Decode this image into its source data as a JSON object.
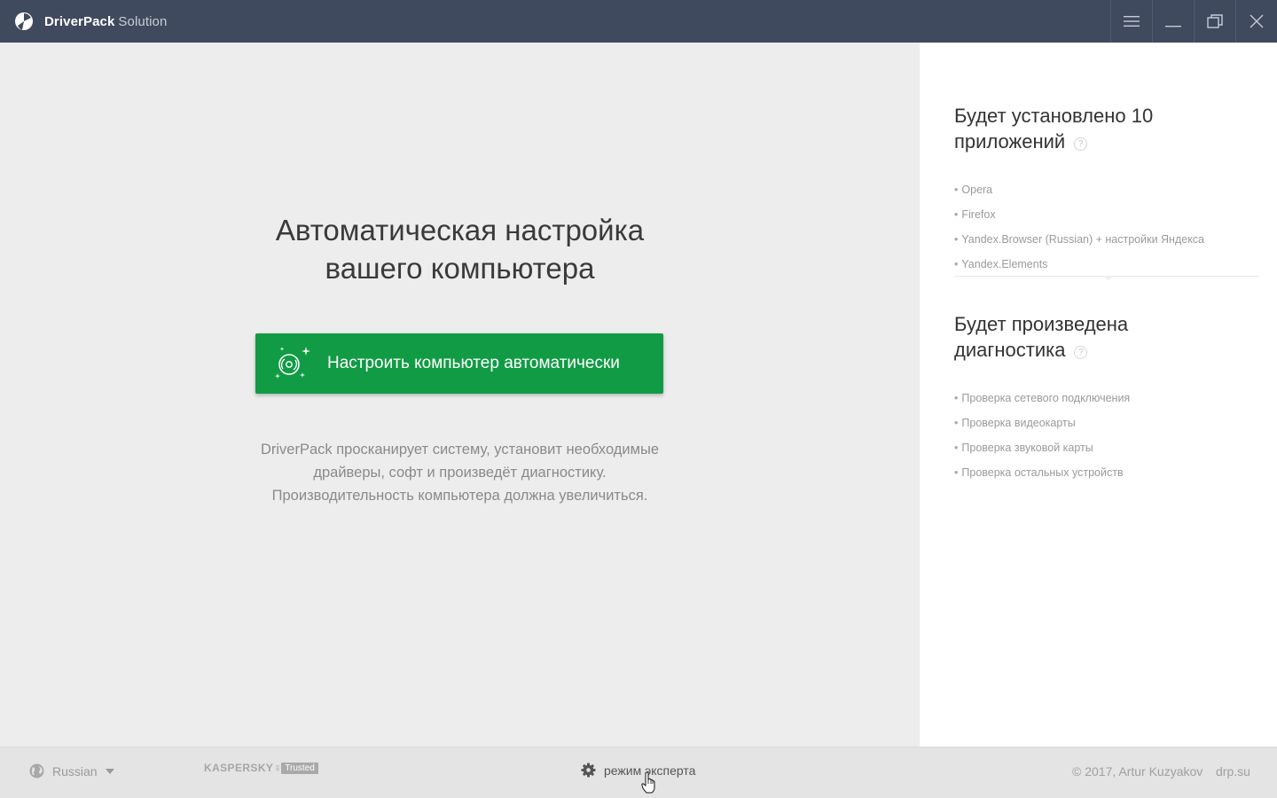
{
  "titlebar": {
    "brand_bold": "DriverPack",
    "brand_light": "Solution",
    "icons": [
      "driverpack-logo-icon",
      "menu-icon",
      "minimize-icon",
      "restore-icon",
      "close-icon"
    ]
  },
  "main": {
    "headline": [
      "Автоматическая настройка",
      "вашего компьютера"
    ],
    "cta_label": "Настроить компьютер автоматически",
    "cta_color": "#119b45",
    "description": [
      "DriverPack просканирует систему, установит необходимые",
      "драйверы, софт и произведёт диагностику.",
      "Производительность компьютера должна увеличиться."
    ]
  },
  "side": {
    "apps": {
      "heading": [
        "Будет установлено 10",
        "приложений"
      ],
      "help": "?",
      "items": [
        "Opera",
        "Firefox",
        "Yandex.Browser (Russian) + настройки Яндекса",
        "Yandex.Elements"
      ]
    },
    "diagnostics": {
      "heading": [
        "Будет произведена",
        "диагностика"
      ],
      "help": "?",
      "items": [
        "Проверка сетевого подключения",
        "Проверка видеокарты",
        "Проверка звуковой карты",
        "Проверка остальных устройств"
      ]
    }
  },
  "footer": {
    "language": "Russian",
    "kaspersky_logo": "KASPERSKY",
    "kaspersky_lab": "lab",
    "kaspersky_badge": "Trusted",
    "expert_mode": "режим эксперта",
    "copyright": "© 2017, Artur Kuzyakov",
    "site": "drp.su"
  },
  "colors": {
    "titlebar": "#3f4a5e",
    "accent_green": "#119b45",
    "main_bg": "#ededed",
    "footer_bg": "#e4e4e4"
  }
}
